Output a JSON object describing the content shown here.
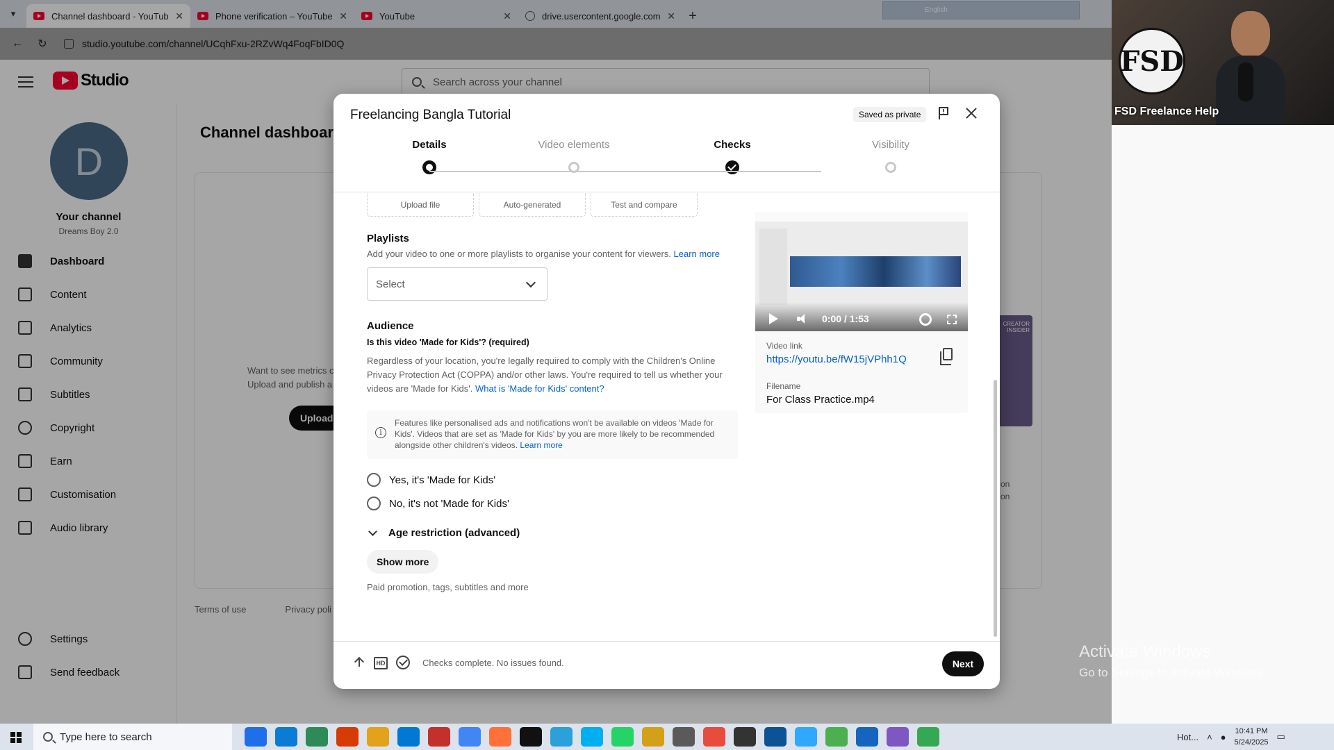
{
  "browser": {
    "tabs": [
      {
        "label": "Channel dashboard - YouTube St",
        "active": true,
        "icon": "youtube-icon"
      },
      {
        "label": "Phone verification – YouTube",
        "active": false,
        "icon": "youtube-icon"
      },
      {
        "label": "YouTube",
        "active": false,
        "icon": "youtube-icon"
      },
      {
        "label": "drive.usercontent.google.com",
        "active": false,
        "icon": "globe-icon"
      }
    ],
    "url": "studio.youtube.com/channel/UCqhFxu-2RZvWq4FoqFbID0Q",
    "overlay_toolbar_lang": "English"
  },
  "studio": {
    "logo_text": "Studio",
    "search_placeholder": "Search across your channel",
    "channel_initial": "D",
    "channel_title": "Your channel",
    "channel_name": "Dreams Boy 2.0",
    "nav": [
      {
        "label": "Dashboard",
        "active": true
      },
      {
        "label": "Content",
        "active": false
      },
      {
        "label": "Analytics",
        "active": false
      },
      {
        "label": "Community",
        "active": false
      },
      {
        "label": "Subtitles",
        "active": false
      },
      {
        "label": "Copyright",
        "active": false
      },
      {
        "label": "Earn",
        "active": false
      },
      {
        "label": "Customisation",
        "active": false
      },
      {
        "label": "Audio library",
        "active": false
      }
    ],
    "nav_bottom": [
      {
        "label": "Settings"
      },
      {
        "label": "Send feedback"
      }
    ],
    "page_title": "Channel dashboard",
    "upload_hint_line1": "Want to see metrics c",
    "upload_hint_line2": "Upload and publish a",
    "upload_button": "Upload",
    "footer_links": [
      "Terms of use",
      "Privacy poli"
    ],
    "creator_insider_label": "CREATOR INSIDER",
    "side_text_1": "on",
    "side_text_2": "on"
  },
  "webcam": {
    "logo_text": "FSD",
    "caption": "FSD Freelance Help"
  },
  "modal": {
    "title": "Freelancing Bangla Tutorial",
    "saved_badge": "Saved as private",
    "steps": [
      {
        "label": "Details",
        "state": "current"
      },
      {
        "label": "Video elements",
        "state": "todo"
      },
      {
        "label": "Checks",
        "state": "done"
      },
      {
        "label": "Visibility",
        "state": "todo"
      }
    ],
    "thumb_options": [
      "Upload file",
      "Auto-generated",
      "Test and compare"
    ],
    "playlists": {
      "heading": "Playlists",
      "description": "Add your video to one or more playlists to organise your content for viewers.",
      "learn_more": "Learn more",
      "select_placeholder": "Select"
    },
    "audience": {
      "heading": "Audience",
      "question": "Is this video 'Made for Kids'? (required)",
      "body": "Regardless of your location, you're legally required to comply with the Children's Online Privacy Protection Act (COPPA) and/or other laws. You're required to tell us whether your videos are 'Made for Kids'.",
      "body_link": "What is 'Made for Kids' content?",
      "info_text": "Features like personalised ads and notifications won't be available on videos 'Made for Kids'. Videos that are set as 'Made for Kids' by you are more likely to be recommended alongside other children's videos.",
      "info_link": "Learn more",
      "option_yes": "Yes, it's 'Made for Kids'",
      "option_no": "No, it's not 'Made for Kids'",
      "age_restriction": "Age restriction (advanced)"
    },
    "show_more": "Show more",
    "show_more_hint": "Paid promotion, tags, subtitles and more",
    "preview": {
      "time": "0:00 / 1:53",
      "video_link_label": "Video link",
      "video_link": "https://youtu.be/fW15jVPhh1Q",
      "filename_label": "Filename",
      "filename": "For Class Practice.mp4"
    },
    "footer_status": "Checks complete. No issues found.",
    "next_button": "Next"
  },
  "watermark": {
    "line1": "Activate Windows",
    "line2": "Go to Settings to activate Windows."
  },
  "taskbar": {
    "search_placeholder": "Type here to search",
    "tray_text": "Hot...",
    "time": "10:41 PM",
    "date": "5/24/2025",
    "colors": [
      "#1f6feb",
      "#0a7cd6",
      "#2e8b57",
      "#d83b01",
      "#e3a21a",
      "#0078d4",
      "#c4302b",
      "#4285f4",
      "#ff7139",
      "#111111",
      "#2aa1da",
      "#00aff0",
      "#25d366",
      "#d4a017",
      "#5a5a5a",
      "#e74c3c",
      "#333333",
      "#0b5394",
      "#31a8ff",
      "#4caf50",
      "#1565c0",
      "#7e57c2",
      "#34a853"
    ]
  }
}
